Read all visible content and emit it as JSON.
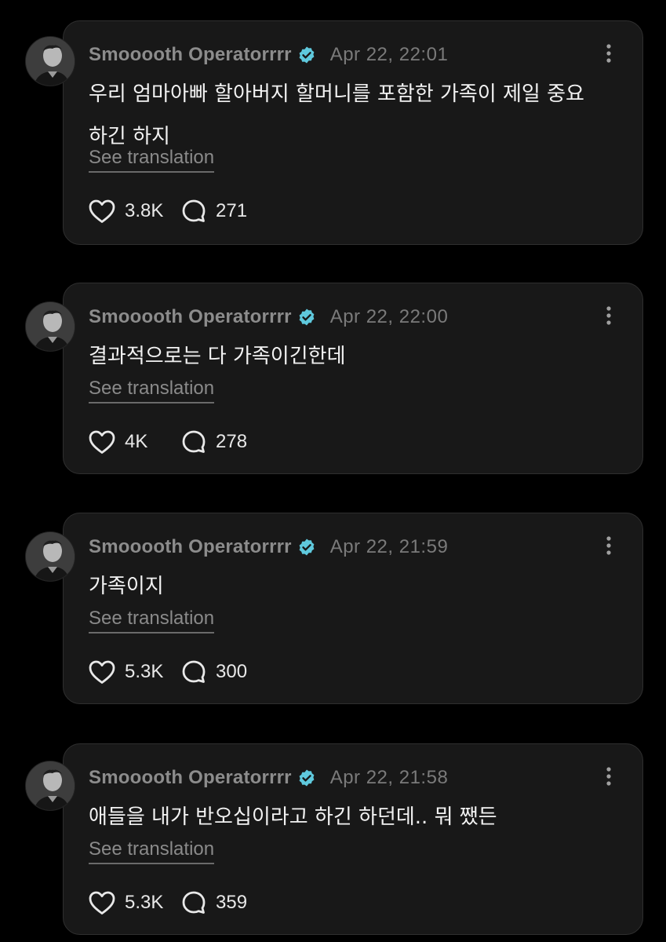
{
  "posts": [
    {
      "author": "Smooooth Operatorrrr",
      "timestamp": "Apr 22, 22:01",
      "text": "우리 엄마아빠 할아버지 할머니를 포함한 가족이 제일 중요하긴 하지",
      "translate_label": "See translation",
      "likes": "3.8K",
      "replies": "271"
    },
    {
      "author": "Smooooth Operatorrrr",
      "timestamp": "Apr 22, 22:00",
      "text": "결과적으로는 다 가족이긴한데",
      "translate_label": "See translation",
      "likes": "4K",
      "replies": "278"
    },
    {
      "author": "Smooooth Operatorrrr",
      "timestamp": "Apr 22, 21:59",
      "text": "가족이지",
      "translate_label": "See translation",
      "likes": "5.3K",
      "replies": "300"
    },
    {
      "author": "Smooooth Operatorrrr",
      "timestamp": "Apr 22, 21:58",
      "text": "애들을 내가 반오십이라고 하긴 하던데.. 뭐 쨌든",
      "translate_label": "See translation",
      "likes": "5.3K",
      "replies": "359"
    }
  ],
  "icons": {
    "verified": "verified-badge-icon",
    "more": "more-vertical-icon",
    "like": "heart-icon",
    "reply": "comment-bubble-icon",
    "avatar": "profile-avatar"
  },
  "colors": {
    "background": "#000000",
    "card": "#181818",
    "verified": "#5fc9dd",
    "text": "#f2f2f2",
    "muted": "#8c8c8c"
  }
}
